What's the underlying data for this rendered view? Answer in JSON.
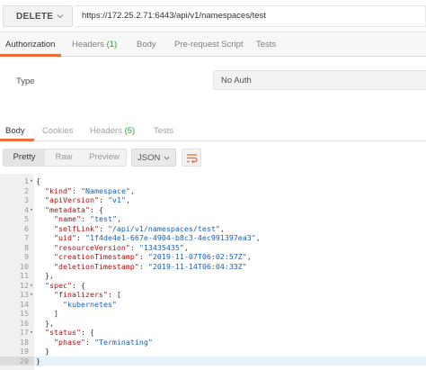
{
  "request": {
    "method": "DELETE",
    "url": "https://172.25.2.71:6443/api/v1/namespaces/test"
  },
  "request_tabs": {
    "authorization": "Authorization",
    "headers": "Headers",
    "headers_count": "(1)",
    "body": "Body",
    "prerequest": "Pre-request Script",
    "tests": "Tests"
  },
  "auth": {
    "type_label": "Type",
    "type_value": "No Auth"
  },
  "response_tabs": {
    "body": "Body",
    "cookies": "Cookies",
    "headers": "Headers",
    "headers_count": "(5)",
    "tests": "Tests"
  },
  "view": {
    "pretty": "Pretty",
    "raw": "Raw",
    "preview": "Preview",
    "format": "JSON"
  },
  "code_lines": [
    {
      "n": "1",
      "fold": "▾",
      "parts": [
        [
          "p",
          "{"
        ]
      ]
    },
    {
      "n": "2",
      "fold": "",
      "parts": [
        [
          "p",
          "  "
        ],
        [
          "k",
          "\"kind\""
        ],
        [
          "p",
          ": "
        ],
        [
          "s",
          "\"Namespace\""
        ],
        [
          "p",
          ","
        ]
      ]
    },
    {
      "n": "3",
      "fold": "",
      "parts": [
        [
          "p",
          "  "
        ],
        [
          "k",
          "\"apiVersion\""
        ],
        [
          "p",
          ": "
        ],
        [
          "s",
          "\"v1\""
        ],
        [
          "p",
          ","
        ]
      ]
    },
    {
      "n": "4",
      "fold": "▾",
      "parts": [
        [
          "p",
          "  "
        ],
        [
          "k",
          "\"metadata\""
        ],
        [
          "p",
          ": {"
        ]
      ]
    },
    {
      "n": "5",
      "fold": "",
      "parts": [
        [
          "p",
          "    "
        ],
        [
          "k",
          "\"name\""
        ],
        [
          "p",
          ": "
        ],
        [
          "s",
          "\"test\""
        ],
        [
          "p",
          ","
        ]
      ]
    },
    {
      "n": "6",
      "fold": "",
      "parts": [
        [
          "p",
          "    "
        ],
        [
          "k",
          "\"selfLink\""
        ],
        [
          "p",
          ": "
        ],
        [
          "s",
          "\"/api/v1/namespaces/test\""
        ],
        [
          "p",
          ","
        ]
      ]
    },
    {
      "n": "7",
      "fold": "",
      "parts": [
        [
          "p",
          "    "
        ],
        [
          "k",
          "\"uid\""
        ],
        [
          "p",
          ": "
        ],
        [
          "s",
          "\"1f4de4e1-667e-4904-b8c3-4ec991397ea3\""
        ],
        [
          "p",
          ","
        ]
      ]
    },
    {
      "n": "8",
      "fold": "",
      "parts": [
        [
          "p",
          "    "
        ],
        [
          "k",
          "\"resourceVersion\""
        ],
        [
          "p",
          ": "
        ],
        [
          "s",
          "\"13435435\""
        ],
        [
          "p",
          ","
        ]
      ]
    },
    {
      "n": "9",
      "fold": "",
      "parts": [
        [
          "p",
          "    "
        ],
        [
          "k",
          "\"creationTimestamp\""
        ],
        [
          "p",
          ": "
        ],
        [
          "s",
          "\"2019-11-07T06:02:57Z\""
        ],
        [
          "p",
          ","
        ]
      ]
    },
    {
      "n": "10",
      "fold": "",
      "parts": [
        [
          "p",
          "    "
        ],
        [
          "k",
          "\"deletionTimestamp\""
        ],
        [
          "p",
          ": "
        ],
        [
          "s",
          "\"2019-11-14T06:04:33Z\""
        ]
      ]
    },
    {
      "n": "11",
      "fold": "",
      "parts": [
        [
          "p",
          "  },"
        ]
      ]
    },
    {
      "n": "12",
      "fold": "▾",
      "parts": [
        [
          "p",
          "  "
        ],
        [
          "k",
          "\"spec\""
        ],
        [
          "p",
          ": {"
        ]
      ]
    },
    {
      "n": "13",
      "fold": "▾",
      "parts": [
        [
          "p",
          "    "
        ],
        [
          "k",
          "\"finalizers\""
        ],
        [
          "p",
          ": ["
        ]
      ]
    },
    {
      "n": "14",
      "fold": "",
      "parts": [
        [
          "p",
          "      "
        ],
        [
          "s",
          "\"kubernetes\""
        ]
      ]
    },
    {
      "n": "15",
      "fold": "",
      "parts": [
        [
          "p",
          "    ]"
        ]
      ]
    },
    {
      "n": "16",
      "fold": "",
      "parts": [
        [
          "p",
          "  },"
        ]
      ]
    },
    {
      "n": "17",
      "fold": "▾",
      "parts": [
        [
          "p",
          "  "
        ],
        [
          "k",
          "\"status\""
        ],
        [
          "p",
          ": {"
        ]
      ]
    },
    {
      "n": "18",
      "fold": "",
      "parts": [
        [
          "p",
          "    "
        ],
        [
          "k",
          "\"phase\""
        ],
        [
          "p",
          ": "
        ],
        [
          "s",
          "\"Terminating\""
        ]
      ]
    },
    {
      "n": "19",
      "fold": "",
      "parts": [
        [
          "p",
          "  }"
        ]
      ]
    },
    {
      "n": "20",
      "fold": "",
      "parts": [
        [
          "p",
          "}"
        ]
      ]
    }
  ],
  "colors": {
    "accent": "#f26b3a",
    "count_green": "#2f9a4a",
    "json_key": "#aa1111",
    "json_string": "#1a5fb4"
  }
}
